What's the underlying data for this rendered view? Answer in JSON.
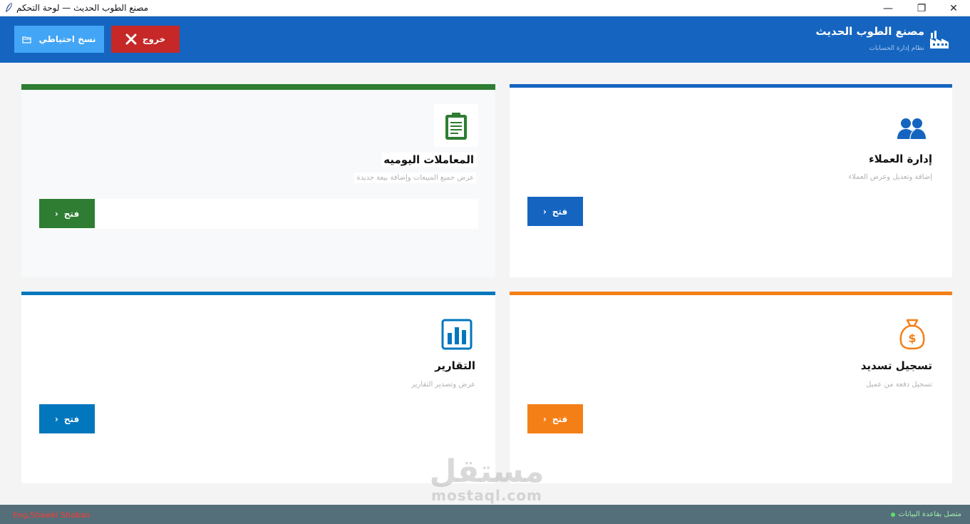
{
  "window": {
    "title": "مصنع الطوب الحديث — لوحة التحكم",
    "min_glyph": "—",
    "max_glyph": "❐",
    "close_glyph": "✕"
  },
  "header": {
    "brand_title": "مصنع الطوب الحديث",
    "brand_subtitle": "نظام إدارة الحسابات",
    "backup_label": "نسخ احتياطي",
    "exit_label": "خروج",
    "color": "#1565c0"
  },
  "cards": {
    "clients": {
      "title": "إدارة العملاء",
      "description": "إضافة وتعديل وعرض العملاء",
      "button_label": "فتح",
      "accent": "#1565c0",
      "icon": "users-icon"
    },
    "daily": {
      "title": "المعاملات اليوميه",
      "description": "عرض جميع المبيعات وإضافة بيعة جديدة",
      "button_label": "فتح",
      "accent": "#2e7d32",
      "icon": "clipboard-icon"
    },
    "payment": {
      "title": "تسجيل تسديد",
      "description": "تسجيل دفعة من عميل",
      "button_label": "فتح",
      "accent": "#f57f17",
      "icon": "money-bag-icon"
    },
    "reports": {
      "title": "التقارير",
      "description": "عرض وتصدير التقارير",
      "button_label": "فتح",
      "accent": "#0277bd",
      "icon": "bar-chart-icon"
    }
  },
  "footer": {
    "author": "Eng.Shawki Shaban",
    "status": "متصل بقاعدة البيانات"
  },
  "watermark": {
    "arabic": "مستقل",
    "latin": "mostaql.com"
  }
}
